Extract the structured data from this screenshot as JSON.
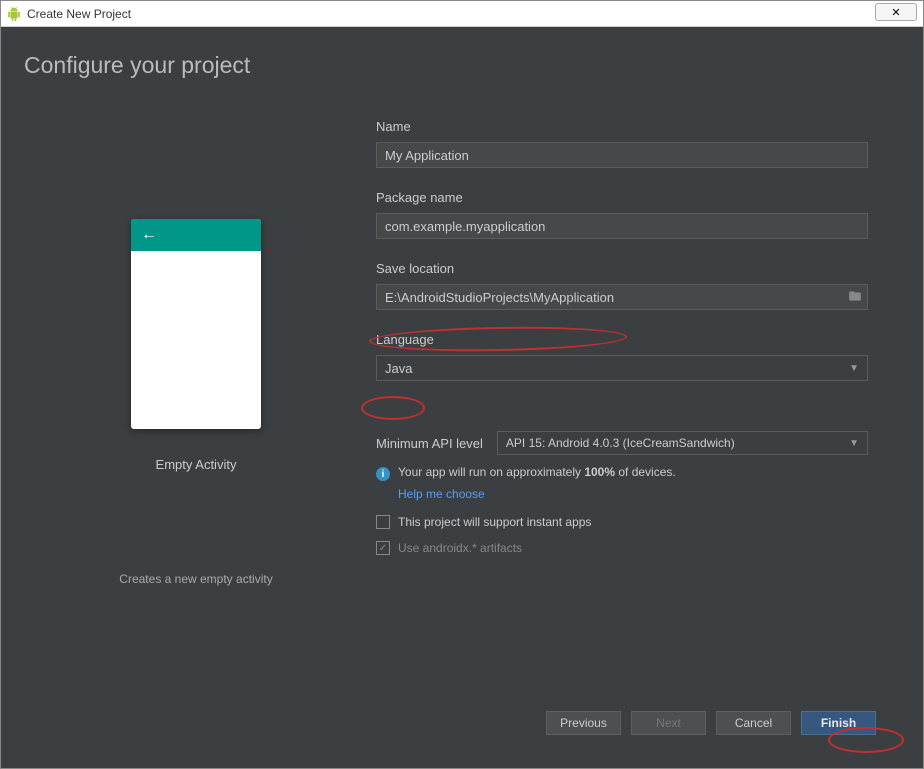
{
  "window": {
    "title": "Create New Project",
    "close_glyph": "✕"
  },
  "page": {
    "heading": "Configure your project"
  },
  "preview": {
    "activity_name": "Empty Activity",
    "description": "Creates a new empty activity",
    "back_arrow": "←"
  },
  "fields": {
    "name": {
      "label": "Name",
      "value": "My Application"
    },
    "package": {
      "label": "Package name",
      "value": "com.example.myapplication"
    },
    "save_location": {
      "label": "Save location",
      "value": "E:\\AndroidStudioProjects\\MyApplication"
    },
    "language": {
      "label": "Language",
      "value": "Java"
    },
    "min_api": {
      "label": "Minimum API level",
      "value": "API 15: Android 4.0.3 (IceCreamSandwich)"
    }
  },
  "info": {
    "text_prefix": "Your app will run on approximately ",
    "percent": "100%",
    "text_suffix": " of devices.",
    "help_link": "Help me choose"
  },
  "checkboxes": {
    "instant_apps": {
      "label": "This project will support instant apps",
      "checked": false
    },
    "androidx": {
      "label": "Use androidx.* artifacts",
      "checked": true,
      "disabled": true
    }
  },
  "buttons": {
    "previous": "Previous",
    "next": "Next",
    "cancel": "Cancel",
    "finish": "Finish"
  }
}
